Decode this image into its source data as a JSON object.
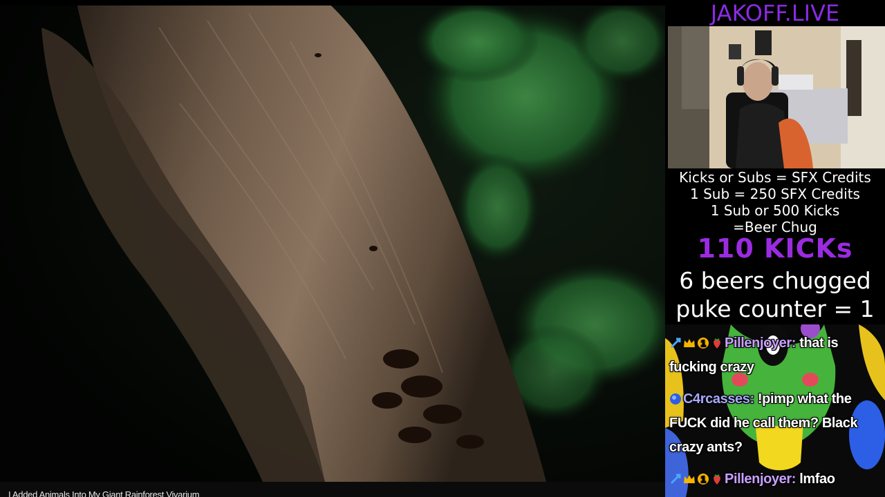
{
  "video": {
    "title": "I Added Animals Into My Giant Rainforest Vivarium"
  },
  "overlay": {
    "channel_name": "JAKOFF.LIVE",
    "info_lines": [
      "Kicks or Subs = SFX Credits",
      "1 Sub = 250 SFX Credits",
      "1 Sub or 500 Kicks",
      "=Beer Chug"
    ],
    "kicks_counter": "110 KICKs",
    "beers_counter": "6 beers chugged",
    "puke_counter": "puke counter = 1",
    "colors": {
      "channel_name": "#8a2be2",
      "kicks_counter": "#9b2be0"
    }
  },
  "chat": {
    "messages": [
      {
        "username": "Pillenjoyer",
        "username_color": "#c9a0ff",
        "badges": [
          "sword-badge-icon",
          "crown-badge-icon",
          "one-badge-icon",
          "strawberry-badge-icon"
        ],
        "text": "that is fucking crazy"
      },
      {
        "username": "C4rcasses",
        "username_color": "#a9a9ff",
        "badges": [
          "blue-orb-badge-icon"
        ],
        "text": "!pimp what the FUCK did he call them? Black crazy ants?"
      },
      {
        "username": "Pillenjoyer",
        "username_color": "#c9a0ff",
        "badges": [
          "sword-badge-icon",
          "crown-badge-icon",
          "one-badge-icon",
          "strawberry-badge-icon"
        ],
        "text": "lmfao"
      }
    ]
  }
}
